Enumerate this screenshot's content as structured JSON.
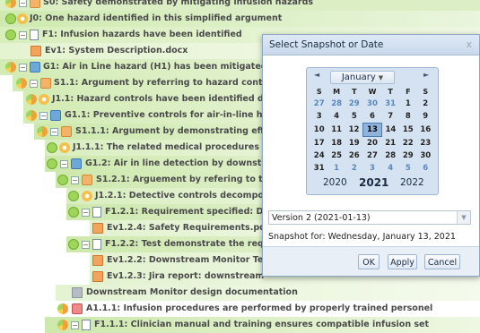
{
  "tree": {
    "rows": [
      {
        "label": "S0: Safety demonstrated by mitigating infusion hazards"
      },
      {
        "label": "J0: One hazard identified in this simplified argument"
      },
      {
        "label": "F1: Infusion hazards have been identified"
      },
      {
        "label": "Ev1: System Description.docx"
      },
      {
        "label": "G1: Air in Line hazard (H1) has been mitigated"
      },
      {
        "label": "S1.1: Argument by referring to hazard controls"
      },
      {
        "label": "J1.1: Hazard controls have been identified durin"
      },
      {
        "label": "G1.1: Preventive controls for air-in-line hazard a"
      },
      {
        "label": "S1.1.1: Argument by demonstrating effective"
      },
      {
        "label": "J1.1.1: The related medical procedures ar"
      },
      {
        "label": "G1.2: Air in line detection by downstream"
      },
      {
        "label": "S1.2.1: Arguement by refering to the re"
      },
      {
        "label": "J1.2.1: Detective controls decompo"
      },
      {
        "label": "F1.2.1: Requirement specified: Dow"
      },
      {
        "label": "Ev1.2.4: Safety Requirements.pd"
      },
      {
        "label": "F1.2.2: Test demonstrate the requir"
      },
      {
        "label": "Ev1.2.2: Downstream Monitor Te"
      },
      {
        "label": "Ev1.2.3: Jira report: downstream"
      },
      {
        "label": "Downstream Monitor design documentation"
      },
      {
        "label": "A1.1.1: Infusion procedures are performed by properly trained personel"
      },
      {
        "label": "F1.1.1: Clinician manual and training ensures compatible infusion set"
      }
    ],
    "overflow_text": "rain"
  },
  "dialog": {
    "title": "Select Snapshot or Date",
    "close_label": "x",
    "calendar": {
      "month": "January",
      "prev_label": "◄",
      "next_label": "►",
      "weekdays": [
        "S",
        "M",
        "T",
        "W",
        "T",
        "F",
        "S"
      ],
      "weeks": [
        [
          "27",
          "28",
          "29",
          "30",
          "31",
          "1",
          "2"
        ],
        [
          "3",
          "4",
          "5",
          "6",
          "7",
          "8",
          "9"
        ],
        [
          "10",
          "11",
          "12",
          "13",
          "14",
          "15",
          "16"
        ],
        [
          "17",
          "18",
          "19",
          "20",
          "21",
          "22",
          "23"
        ],
        [
          "24",
          "25",
          "26",
          "27",
          "28",
          "29",
          "30"
        ],
        [
          "31",
          "1",
          "2",
          "3",
          "4",
          "5",
          "6"
        ]
      ],
      "selected_day": "13",
      "years": [
        "2020",
        "2021",
        "2022"
      ],
      "current_year": "2021"
    },
    "version_select": "Version 2 (2021-01-13)",
    "snapshot_text": "Snapshot for:  Wednesday, January 13, 2021",
    "buttons": {
      "ok": "OK",
      "apply": "Apply",
      "cancel": "Cancel"
    }
  }
}
